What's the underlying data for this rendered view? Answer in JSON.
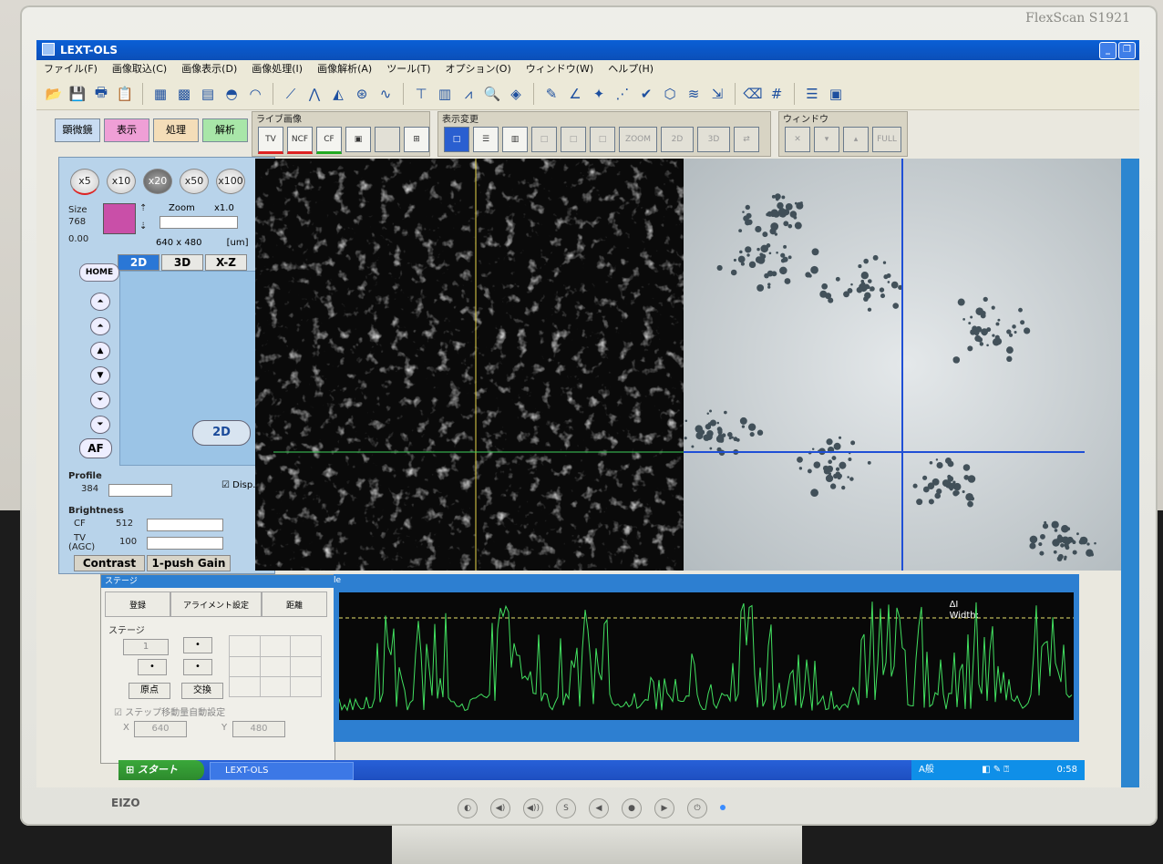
{
  "monitor": {
    "model": "FlexScan S1921",
    "brand": "EIZO"
  },
  "window": {
    "title": "LEXT-OLS",
    "minimize_label": "_",
    "restore_label": "❐"
  },
  "menu": [
    "ファイル(F)",
    "画像取込(C)",
    "画像表示(D)",
    "画像処理(I)",
    "画像解析(A)",
    "ツール(T)",
    "オプション(O)",
    "ウィンドウ(W)",
    "ヘルプ(H)"
  ],
  "mode_tabs": [
    {
      "label": "顕微鏡",
      "color": "#c9dcf2"
    },
    {
      "label": "表示",
      "color": "#ef9fd6"
    },
    {
      "label": "処理",
      "color": "#f4ddb8"
    },
    {
      "label": "解析",
      "color": "#a8e6a8"
    }
  ],
  "groups": {
    "live": {
      "label": "ライブ画像",
      "buttons": [
        "TV",
        "NCF",
        "CF"
      ]
    },
    "display": {
      "label": "表示変更",
      "zoom_label": "ZOOM",
      "btn_2d": "2D",
      "btn_3d": "3D"
    },
    "window": {
      "label": "ウィンドウ",
      "full_label": "FULL"
    }
  },
  "microscope": {
    "objectives": [
      "x5",
      "x10",
      "x20",
      "x50",
      "x100"
    ],
    "selected_objective": "x20",
    "size_label": "Size",
    "size_value": "768",
    "size_min": "0.00",
    "zoom_label": "Zoom",
    "zoom_value": "x1.0",
    "resolution": "640 x 480",
    "unit": "[um]",
    "home_label": "HOME",
    "view_tabs": [
      "2D",
      "3D",
      "X-Z"
    ],
    "af_label": "AF",
    "mode_button": "2D",
    "profile_label": "Profile",
    "profile_value": "384",
    "disp_label": "Disp.",
    "brightness_label": "Brightness",
    "cf_label": "CF",
    "cf_value": "512",
    "tv_label": "TV",
    "agc_label": "(AGC)",
    "tv_value": "100",
    "contrast_label": "Contrast",
    "gain_label": "1-push Gain"
  },
  "stage": {
    "title": "ステージ",
    "register_label": "登録",
    "alignment_label": "アライメント設定",
    "distance_label": "距離",
    "group_label": "ステージ",
    "step_value": "1",
    "origin_label": "原点",
    "convert_label": "交換",
    "auto_step_label": "ステップ移動量自動設定",
    "x_label": "X",
    "x_value": "640",
    "y_label": "Y",
    "y_value": "480"
  },
  "profile_window": {
    "title": "le",
    "delta_label": "ΔI",
    "width_label": "Width:"
  },
  "taskbar": {
    "start_label": "スタート",
    "task_label": "LEXT-OLS",
    "ime_label": "A般",
    "clock": "0:58"
  }
}
